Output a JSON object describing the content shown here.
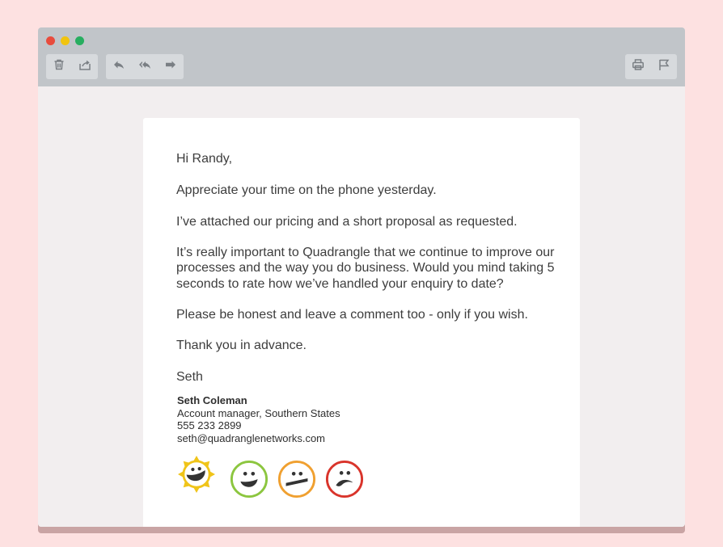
{
  "window": {
    "traffic_lights": [
      "close",
      "minimize",
      "maximize"
    ],
    "colors": {
      "close": "#e84c3d",
      "minimize": "#f1c40f",
      "maximize": "#27ae60"
    }
  },
  "toolbar": {
    "left_group": [
      {
        "name": "trash-icon"
      },
      {
        "name": "move-to-icon"
      }
    ],
    "reply_group": [
      {
        "name": "reply-icon"
      },
      {
        "name": "reply-all-icon"
      },
      {
        "name": "forward-icon"
      }
    ],
    "right_group": [
      {
        "name": "print-icon"
      },
      {
        "name": "flag-icon"
      }
    ]
  },
  "email": {
    "greeting": "Hi Randy,",
    "p1": "Appreciate your time on the phone yesterday.",
    "p2": "I’ve attached our pricing and a short proposal as requested.",
    "p3_line1": "It’s really important to Quadrangle that we continue to improve our",
    "p3_line2": "processes and the way you do business. Would you mind taking 5",
    "p3_line3": "seconds to rate how we’ve handled your enquiry to date?",
    "p4": "Please be honest and leave a comment too - only if you wish.",
    "p5": "Thank you in advance.",
    "signoff": "Seth",
    "signature": {
      "name": "Seth Coleman",
      "title": "Account manager, Southern States",
      "phone": "555 233 2899",
      "email": "seth@quadranglenetworks.com"
    },
    "rating_options": [
      {
        "name": "excellent-rating-icon",
        "color": "#f0c419"
      },
      {
        "name": "good-rating-icon",
        "color": "#8cc63f"
      },
      {
        "name": "neutral-rating-icon",
        "color": "#f0a030"
      },
      {
        "name": "poor-rating-icon",
        "color": "#d9342b"
      }
    ]
  }
}
